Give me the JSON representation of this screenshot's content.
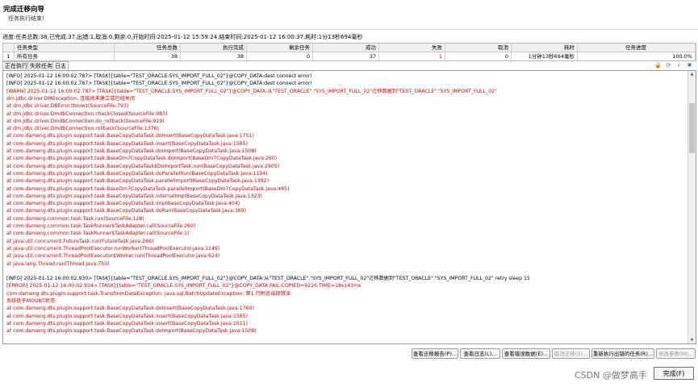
{
  "header": {
    "title": "完成迁移向导",
    "subtitle": "任务执行结束!"
  },
  "progress": "进度:任务总数:38,已完成:37,出错:1,取消:0,剩余:0,开始时间:2025-01-12 15:59:24,结束时间:2025-01-12 16:00:37,耗时:1分13秒694毫秒",
  "stats": {
    "headers": [
      "",
      "任务类型",
      "任务总数",
      "执行完成",
      "剩余任务",
      "成功",
      "失败",
      "取消",
      "耗时",
      "任务进度"
    ],
    "rows": [
      [
        "1",
        "所有任务",
        "38",
        "38",
        "0",
        "37",
        "1",
        "0",
        "1分钟13秒694毫秒",
        "100.0%"
      ]
    ]
  },
  "tabs": [
    "正在执行",
    "失败任务",
    "日志"
  ],
  "active_tab": 2,
  "tab_icons": [
    "lock-icon",
    "refresh-icon",
    "filter-icon",
    "clear-icon"
  ],
  "log_lines": [
    {
      "t": "[INFO] 2025-01-12 16:00:02.787> [TASK]{table=\"TEST_ORACLE.SYS_IMPORT_FULL_02\"}@COPY_DATA:dest connect  error!",
      "k": "info"
    },
    {
      "t": "[INFO] 2025-01-12 16:00:02.787> [TASK]{table=\"TEST_ORACLE.SYS_IMPORT_FULL_02\"}@COPY_DATA:dest connect  error!",
      "k": "info"
    },
    {
      "t": "[WARN] 2025-01-12 16:00:02.787> [TASK]{table=\"TEST_ORACLE.SYS_IMPORT_FULL_02\"}@COPY_DATA:从\"TEST_ORACLE\".\"SYS_IMPORT_FULL_02\"迁移数据到\"TEST_ORACLE\".\"SYS_IMPORT_FULL_02\"",
      "k": "err"
    },
    {
      "t": "dm.jdbc.driver.DMException: 连接尚未建立或已经关闭",
      "k": "err"
    },
    {
      "t": "    at dm.jdbc.driver.DBError.throwz(SourceFile:793)",
      "k": "err"
    },
    {
      "t": "    at dm.jdbc.driver.DmdbConnection.checkClosed(SourceFile:983)",
      "k": "err"
    },
    {
      "t": "    at dm.jdbc.driver.DmdbConnection.do_rollback(SourceFile:919)",
      "k": "err"
    },
    {
      "t": "    at dm.jdbc.driver.DmdbConnection.rollback(SourceFile:1376)",
      "k": "err"
    },
    {
      "t": "    at com.dameng.dts.plugin.support.task.BaseCopyDataTask.doInsert(BaseCopyDataTask.java:1751)",
      "k": "err"
    },
    {
      "t": "    at com.dameng.dts.plugin.support.task.BaseCopyDataTask.insert(BaseCopyDataTask.java:1565)",
      "k": "err"
    },
    {
      "t": "    at com.dameng.dts.plugin.support.task.BaseCopyDataTask.doImport(BaseCopyDataTask.java:1508)",
      "k": "err"
    },
    {
      "t": "    at com.dameng.dts.plugin.support.task.BaseDm7CopyDataTask.doImport(BaseDm7CopyDataTask.java:260)",
      "k": "err"
    },
    {
      "t": "    at com.dameng.dts.plugin.support.task.BaseCopyDataTask$DoImportTask.run(BaseCopyDataTask.java:2905)",
      "k": "err"
    },
    {
      "t": "    at com.dameng.dts.plugin.support.task.BaseCopyDataTask.doParallelRun(BaseCopyDataTask.java:1194)",
      "k": "err"
    },
    {
      "t": "    at com.dameng.dts.plugin.support.task.BaseCopyDataTask.parallelImport(BaseCopyDataTask.java:1392)",
      "k": "err"
    },
    {
      "t": "    at com.dameng.dts.plugin.support.task.BaseDm7CopyDataTask.parallelImport(BaseDm7CopyDataTask.java:465)",
      "k": "err"
    },
    {
      "t": "    at com.dameng.dts.plugin.support.task.BaseCopyDataTask.internalImp(BaseCopyDataTask.java:1323)",
      "k": "err"
    },
    {
      "t": "    at com.dameng.dts.plugin.support.task.BaseCopyDataTask.imp(BaseCopyDataTask.java:404)",
      "k": "err"
    },
    {
      "t": "    at com.dameng.dts.plugin.support.task.BaseCopyDataTask.doRun(BaseCopyDataTask.java:369)",
      "k": "err"
    },
    {
      "t": "    at com.dameng.common.task.Task.run(SourceFile:128)",
      "k": "err"
    },
    {
      "t": "    at com.dameng.common.task.TaskRunner$TaskAdapter.call(SourceFile:260)",
      "k": "err"
    },
    {
      "t": "    at com.dameng.common.task.TaskRunner$TaskAdapter.call(SourceFile:1)",
      "k": "err"
    },
    {
      "t": "    at java.util.concurrent.FutureTask.run(FutureTask.java:266)",
      "k": "err"
    },
    {
      "t": "    at java.util.concurrent.ThreadPoolExecutor.runWorker(ThreadPoolExecutor.java:1149)",
      "k": "err"
    },
    {
      "t": "    at java.util.concurrent.ThreadPoolExecutor$Worker.run(ThreadPoolExecutor.java:624)",
      "k": "err"
    },
    {
      "t": "    at java.lang.Thread.run(Thread.java:750)",
      "k": "err"
    },
    {
      "t": "",
      "k": "info"
    },
    {
      "t": "[INFO] 2025-01-12 16:00:02.930> [TASK]{table=\"TEST_ORACLE.SYS_IMPORT_FULL_02\"}@COPY_DATA:从\"TEST_ORACLE\".\"SYS_IMPORT_FULL_02\"迁移数据到\"TEST_ORACLE\".\"SYS_IMPORT_FULL_02\" retry sleep  15",
      "k": "info"
    },
    {
      "t": "[ERROR] 2025-01-12 16:00:02.934> [TASK]{table=\"TEST_ORACLE.SYS_IMPORT_FULL_03\"}@COPY_DATA:FAIL:COPIED=9216:TIME=18s143ms",
      "k": "err"
    },
    {
      "t": "com.dameng.dts.plugin.support.task.TransformDataException: java.sql.BatchUpdateException: 第1 行附近出现错误:",
      "k": "err"
    },
    {
      "t": "系统处于MOUNT状态",
      "k": "err"
    },
    {
      "t": "    at com.dameng.dts.plugin.support.task.BaseCopyDataTask.doInsert(BaseCopyDataTask.java:1760)",
      "k": "err"
    },
    {
      "t": "    at com.dameng.dts.plugin.support.task.BaseCopyDataTask.insert(BaseCopyDataTask.java:1565)",
      "k": "err"
    },
    {
      "t": "    at com.dameng.dts.plugin.support.task.BaseCopyDataTask.insert(BaseCopyDataTask.java:1611)",
      "k": "err"
    },
    {
      "t": "    at com.dameng.dts.plugin.support.task.BaseCopyDataTask.doImport(BaseCopyDataTask.java:1508)",
      "k": "err"
    }
  ],
  "buttons": [
    {
      "label": "查看迁移报告(P)...",
      "disabled": false
    },
    {
      "label": "查看日志(L)...",
      "disabled": false
    },
    {
      "label": "查看错误数据(E)...",
      "disabled": false
    },
    {
      "label": "取消迁移(S)...",
      "disabled": true
    },
    {
      "label": "重新执行出错的任务(R)...",
      "disabled": false
    },
    {
      "label": "修改参数(M)...",
      "disabled": true
    }
  ],
  "finish_label": "完成(F)",
  "watermark": "CSDN @做梦高手"
}
